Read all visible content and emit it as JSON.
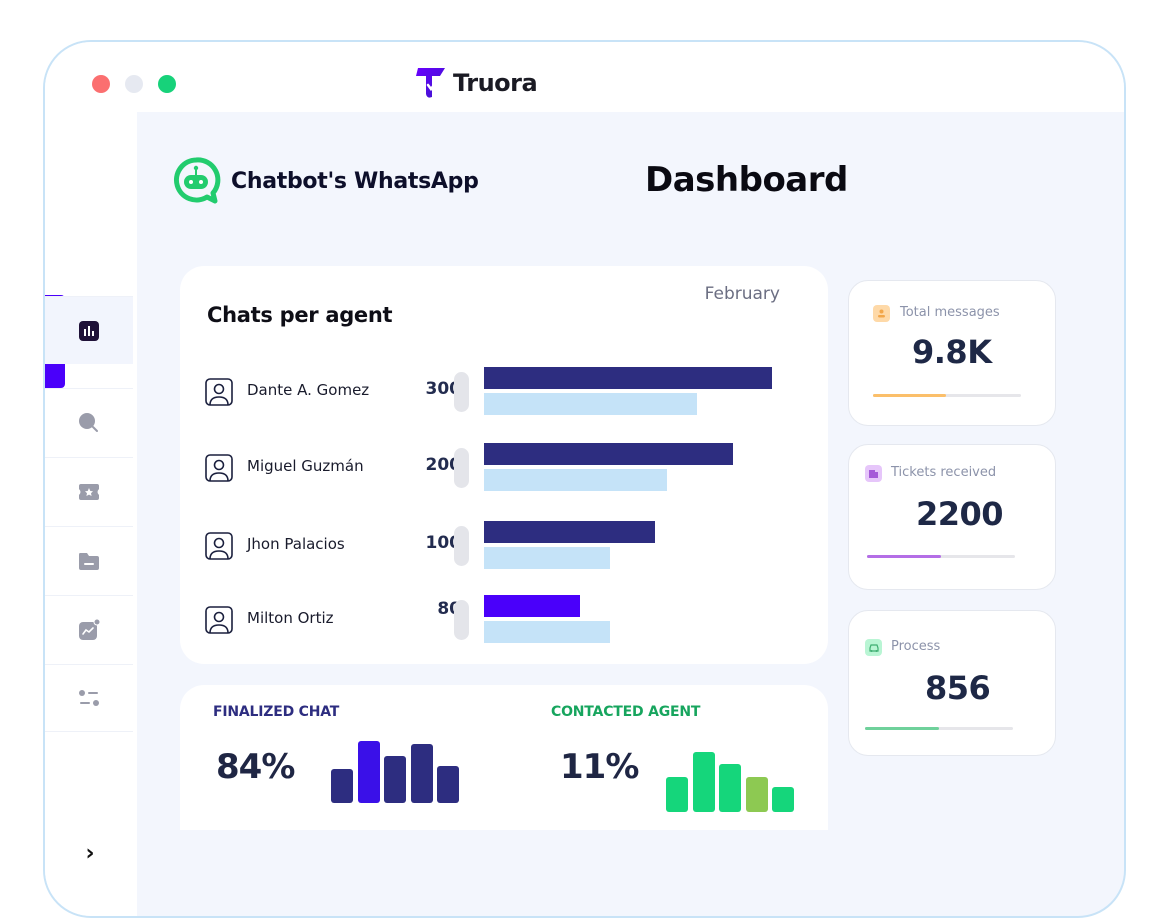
{
  "window": {
    "controls": [
      "close",
      "minimize",
      "maximize"
    ],
    "brand": "Truora",
    "colors": {
      "close": "#fb6f70",
      "minimize": "#e6e9f1",
      "maximize": "#17d27a",
      "accent": "#4a00fa"
    }
  },
  "sidebar": {
    "items": [
      {
        "name": "dashboard",
        "icon": "bar-chart-icon",
        "active": true
      },
      {
        "name": "search",
        "icon": "search-icon",
        "active": false
      },
      {
        "name": "tickets",
        "icon": "ticket-icon",
        "active": false
      },
      {
        "name": "folders",
        "icon": "folder-icon",
        "active": false
      },
      {
        "name": "analytics",
        "icon": "trend-chart-icon",
        "active": false
      },
      {
        "name": "settings",
        "icon": "sliders-icon",
        "active": false
      }
    ],
    "expand_icon": "chevron-right-icon",
    "expand_glyph": "›"
  },
  "header": {
    "app_title": "Chatbot's WhatsApp",
    "page_title": "Dashboard"
  },
  "chats_card": {
    "title": "Chats per agent",
    "period": "February",
    "agents": [
      {
        "name": "Dante A. Gomez",
        "count": "300",
        "primary_fraction": 0.96,
        "secondary_fraction": 0.71,
        "primary_color": "#2d2d80"
      },
      {
        "name": "Miguel Guzmán",
        "count": "200",
        "primary_fraction": 0.83,
        "secondary_fraction": 0.61,
        "primary_color": "#2d2d80"
      },
      {
        "name": "Jhon Palacios",
        "count": "100",
        "primary_fraction": 0.57,
        "secondary_fraction": 0.42,
        "primary_color": "#2d2d80"
      },
      {
        "name": "Milton Ortiz",
        "count": "80",
        "primary_fraction": 0.32,
        "secondary_fraction": 0.42,
        "primary_color": "#4a00fa"
      }
    ],
    "secondary_color": "#c5e3f8"
  },
  "stats_card": {
    "finalized": {
      "label": "FINALIZED CHAT",
      "value": "84%",
      "label_color": "#2d2d80",
      "bars": [
        0.55,
        1.0,
        0.76,
        0.95,
        0.6
      ],
      "bar_colors": [
        "#2d2d80",
        "#3a10e8",
        "#2d2d80",
        "#2d2d80",
        "#2d2d80"
      ]
    },
    "contacted": {
      "label": "CONTACTED AGENT",
      "value": "11%",
      "label_color": "#17a55e",
      "bars": [
        0.58,
        1.0,
        0.8,
        0.58,
        0.41
      ],
      "bar_colors": [
        "#15d67b",
        "#15d67b",
        "#15d67b",
        "#8dc952",
        "#15d67b"
      ]
    }
  },
  "kpis": [
    {
      "label": "Total messages",
      "value": "9.8K",
      "icon": "user-icon",
      "progress": 0.49,
      "color": "#fbbf6a",
      "icon_bg": "#fed9a8"
    },
    {
      "label": "Tickets received",
      "value": "2200",
      "icon": "building-icon",
      "progress": 0.5,
      "color": "#b46ee6",
      "icon_bg": "#e6c6fa"
    },
    {
      "label": "Process",
      "value": "856",
      "icon": "car-icon",
      "progress": 0.5,
      "color": "#6fd19b",
      "icon_bg": "#b9f5d4"
    }
  ]
}
